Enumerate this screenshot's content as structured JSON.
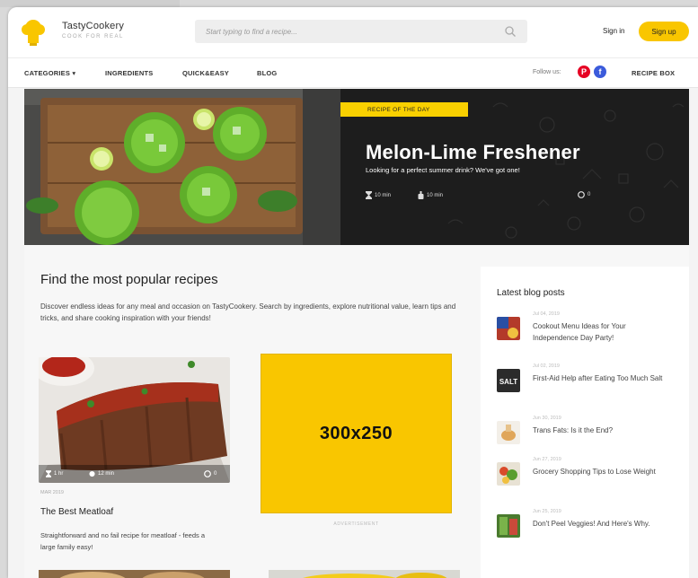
{
  "header": {
    "brand": "TastyCookery",
    "tagline": "COOK FOR REAL",
    "search_placeholder": "Start typing to find a recipe...",
    "signin_label": "Sign in",
    "signup_label": "Sign up"
  },
  "nav": {
    "items": [
      "CATEGORIES ▾",
      "INGREDIENTS",
      "QUICK&EASY",
      "BLOG"
    ],
    "follow_label": "Follow us:",
    "recipe_box_label": "RECIPE BOX"
  },
  "hero": {
    "badge": "RECIPE OF THE DAY",
    "title": "Melon-Lime Freshener",
    "subtitle": "Looking for a perfect summer drink? We've got one!",
    "prep_time": "10 min",
    "cook_time": "10 min",
    "comments": "0"
  },
  "main": {
    "title": "Find the most popular recipes",
    "description": "Discover endless ideas for any meal and occasion on TastyCookery. Search by ingredients, explore nutritional value, learn tips and tricks, and share cooking inspiration with your friends!"
  },
  "card": {
    "time": "1 hr",
    "servings": "12 min",
    "comments": "0",
    "date": "MAR 2019",
    "title": "The Best Meatloaf",
    "description": "Straightforward and no fail recipe for meatloaf - feeds a large family easy!"
  },
  "ad": {
    "size": "300x250",
    "label": "ADVERTISEMENT"
  },
  "sidebar": {
    "title": "Latest blog posts",
    "posts": [
      {
        "date": "Jul 04, 2019",
        "title": "Cookout Menu Ideas for Your Independence Day Party!"
      },
      {
        "date": "Jul 02, 2019",
        "title": "First-Aid Help after Eating Too Much Salt"
      },
      {
        "date": "Jun 30, 2019",
        "title": "Trans Fats: Is it the End?"
      },
      {
        "date": "Jun 27, 2019",
        "title": "Grocery Shopping Tips to Lose Weight"
      },
      {
        "date": "Jun 25, 2019",
        "title": "Don't Peel Veggies! And Here's Why."
      }
    ]
  },
  "colors": {
    "accent": "#f9c600",
    "pinterest": "#e60023",
    "facebook": "#3b5bdb"
  }
}
